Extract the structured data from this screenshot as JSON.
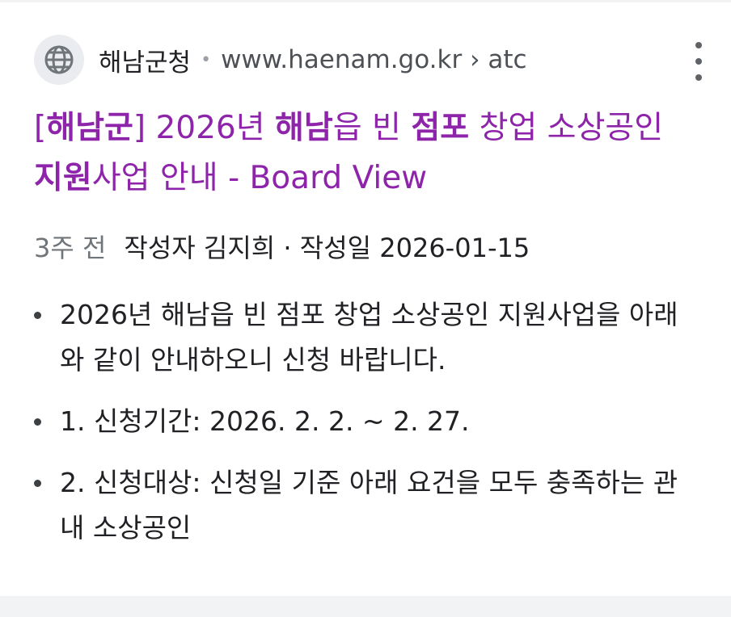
{
  "result": {
    "site_name": "해남군청",
    "separator": "•",
    "url": "www.haenam.go.kr › atc",
    "favicon": "globe-icon",
    "more_icon": "more-vert-icon",
    "title_parts": [
      {
        "text": "[",
        "bold": false
      },
      {
        "text": "해남군",
        "bold": true
      },
      {
        "text": "] 2026년 ",
        "bold": false
      },
      {
        "text": "해남",
        "bold": true
      },
      {
        "text": "읍 빈 ",
        "bold": false
      },
      {
        "text": "점포",
        "bold": true
      },
      {
        "text": " 창업 소상공인 ",
        "bold": false
      },
      {
        "text": "지원",
        "bold": true
      },
      {
        "text": "사업 안내 - Board View",
        "bold": false
      }
    ],
    "title_color": "#8e24aa",
    "age": "3주 전",
    "meta": "작성자 김지희 · 작성일 2026-01-15",
    "bullets": [
      "2026년 해남읍 빈 점포 창업 소상공인 지원사업을 아래와 같이 안내하오니 신청 바랍니다.",
      "1. 신청기간: 2026. 2. 2. ~ 2. 27.",
      "2. 신청대상: 신청일 기준 아래 요건을 모두 충족하는 관내 소상공인"
    ]
  }
}
